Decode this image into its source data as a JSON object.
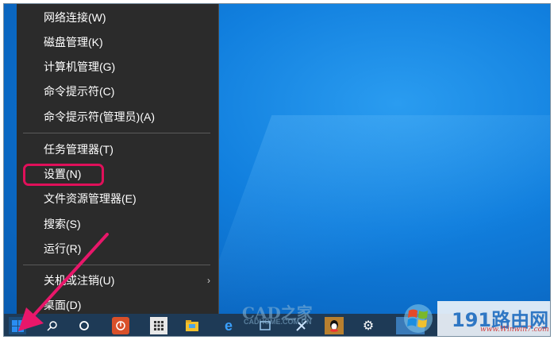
{
  "context_menu": {
    "group1": [
      {
        "label": "网络连接(W)"
      },
      {
        "label": "磁盘管理(K)"
      },
      {
        "label": "计算机管理(G)"
      },
      {
        "label": "命令提示符(C)"
      },
      {
        "label": "命令提示符(管理员)(A)"
      }
    ],
    "group2": [
      {
        "label": "任务管理器(T)"
      },
      {
        "label": "设置(N)"
      },
      {
        "label": "文件资源管理器(E)"
      },
      {
        "label": "搜索(S)"
      },
      {
        "label": "运行(R)"
      }
    ],
    "group3": [
      {
        "label": "关机或注销(U)"
      },
      {
        "label": "桌面(D)"
      }
    ],
    "submenu_arrow": "›"
  },
  "watermarks": {
    "cad_title": "CAD之家",
    "cad_url": "CADHOME.COM.CN",
    "site_name": "191路由网",
    "site_url": "www.Winwin7.com"
  },
  "colors": {
    "menu_bg": "#2b2b2b",
    "highlight": "#e0105a",
    "arrow": "#e8176a",
    "desktop_blue": "#117fde",
    "taskbar": "#1e3a56"
  },
  "taskbar_icons": [
    "windows-start-icon",
    "search-icon",
    "cortana-icon",
    "antivirus-icon",
    "grid-app-icon",
    "folder-icon",
    "edge-icon",
    "app-icon",
    "pin-icon",
    "qq-icon",
    "settings-gear-icon",
    "win7-logo-icon"
  ]
}
